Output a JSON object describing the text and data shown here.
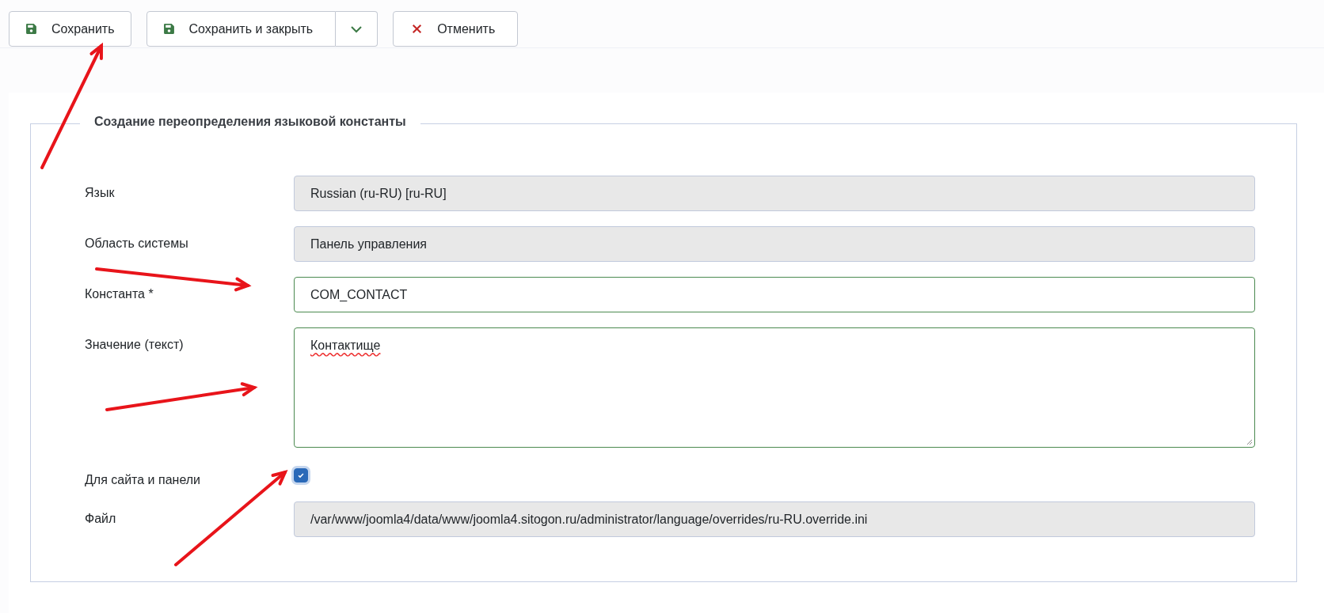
{
  "toolbar": {
    "buttons": [
      {
        "label": "Сохранить",
        "kind": "save"
      },
      {
        "label": "Сохранить и закрыть",
        "kind": "split"
      },
      {
        "label": "Отменить",
        "kind": "cancel"
      }
    ]
  },
  "form": {
    "legend": "Создание переопределения языковой константы",
    "fields": [
      {
        "label": "Язык",
        "kind": "readonly",
        "value": "Russian (ru-RU) [ru-RU]"
      },
      {
        "label": "Область системы",
        "kind": "readonly",
        "value": "Панель управления"
      },
      {
        "label": "Константа *",
        "kind": "text",
        "value": "COM_CONTACT"
      },
      {
        "label": "Значение (текст)",
        "kind": "textarea",
        "value": "Контактище"
      },
      {
        "label": "Для сайта и панели",
        "kind": "checkbox",
        "checked": true
      },
      {
        "label": "Файл",
        "kind": "readonly",
        "value": "/var/www/joomla4/data/www/joomla4.sitogon.ru/administrator/language/overrides/ru-RU.override.ini"
      }
    ]
  }
}
